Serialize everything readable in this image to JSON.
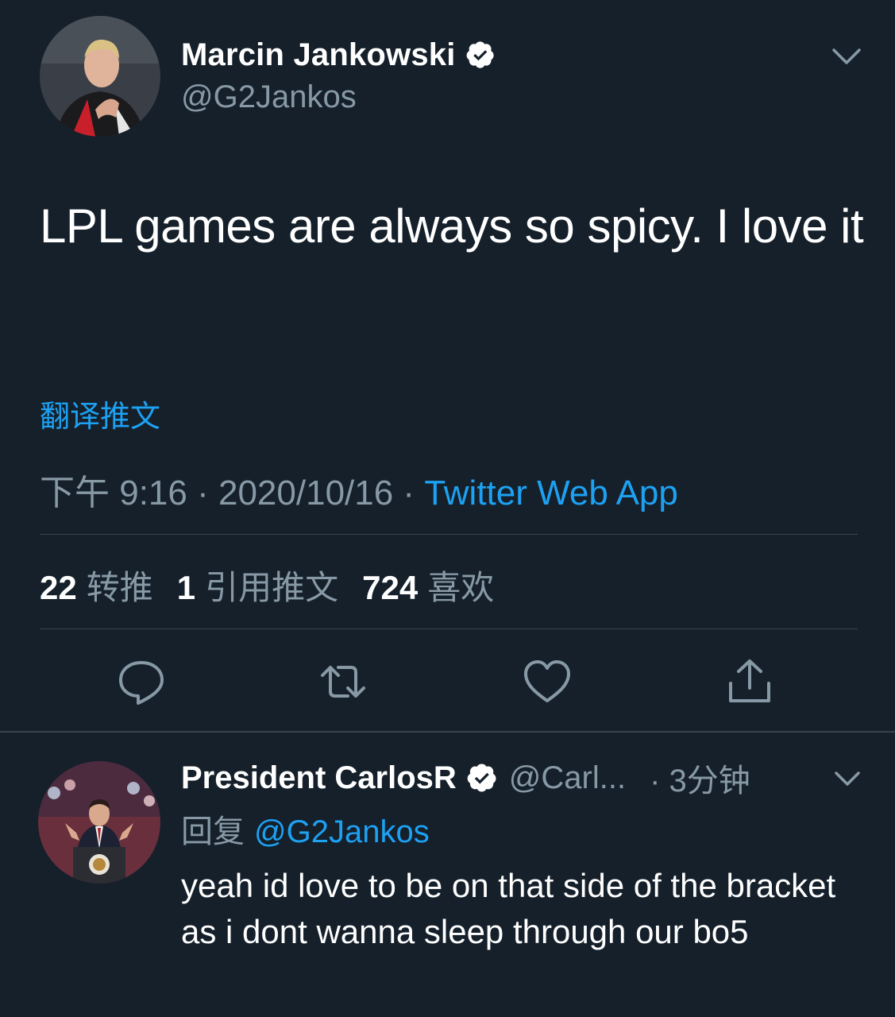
{
  "colors": {
    "background": "#15202b",
    "primary_text": "#ffffff",
    "secondary_text": "#8899a6",
    "accent": "#1da1f2",
    "divider": "#38444d"
  },
  "tweet": {
    "author": {
      "display_name": "Marcin Jankowski",
      "handle": "@G2Jankos",
      "verified": true,
      "verified_icon": "verified-badge-icon",
      "avatar_icon": "avatar"
    },
    "text": "LPL games are always so spicy. I love it",
    "translate_label": "翻译推文",
    "time": "下午 9:16",
    "separator": " · ",
    "date": "2020/10/16",
    "source": "Twitter Web App",
    "stats": {
      "retweets_count": "22",
      "retweets_label": "转推",
      "quotes_count": "1",
      "quotes_label": "引用推文",
      "likes_count": "724",
      "likes_label": "喜欢"
    },
    "actions": [
      "reply-icon",
      "retweet-icon",
      "like-icon",
      "share-icon"
    ]
  },
  "reply": {
    "author": {
      "display_name": "President CarlosR",
      "handle": "@Carl...",
      "verified": true
    },
    "time": "· 3分钟",
    "replying_label": "回复",
    "replying_to": "@G2Jankos",
    "text": "yeah id love to be on that side of the bracket as i dont wanna sleep through our bo5"
  }
}
